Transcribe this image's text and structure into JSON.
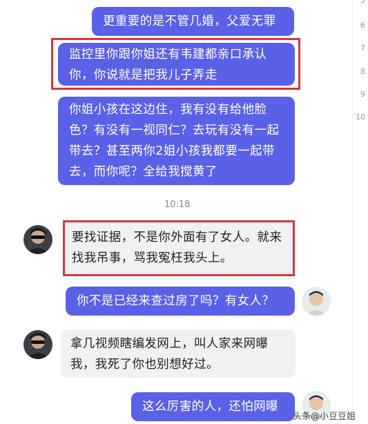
{
  "line_numbers": [
    "5",
    "6",
    "7",
    "8",
    "9",
    "10"
  ],
  "messages": [
    {
      "text": "更重要的是不管几婚，父爱无罪"
    },
    {
      "text": "监控里你跟你姐还有韦建都亲口承认你，你说就是把我儿子弄走"
    },
    {
      "text": "你姐小孩在这边住，我有没有给他脸色？有没有一视同仁？去玩有没有一起带去？甚至两你2姐小孩我都要一起带去，而你呢？全给我搅黄了"
    },
    {
      "text": "要找证据，不是你外面有了女人。就来找我吊事，骂我冤枉我头上。"
    },
    {
      "text": "你不是已经来查过房了吗？有女人？"
    },
    {
      "text": "拿几视频瞎编发网上，叫人家来网曝我，我死了你也别想好过。"
    },
    {
      "text": "这么厉害的人，还怕网曝"
    }
  ],
  "timestamp": "10:18",
  "watermark": "头条@小豆豆姐",
  "colors": {
    "outgoing": "#5b60e8",
    "incoming": "#f1f1f3",
    "highlight": "#d7353c"
  },
  "avatars": {
    "other": "avatar-dark-sunglasses",
    "self": "avatar-light-man"
  }
}
